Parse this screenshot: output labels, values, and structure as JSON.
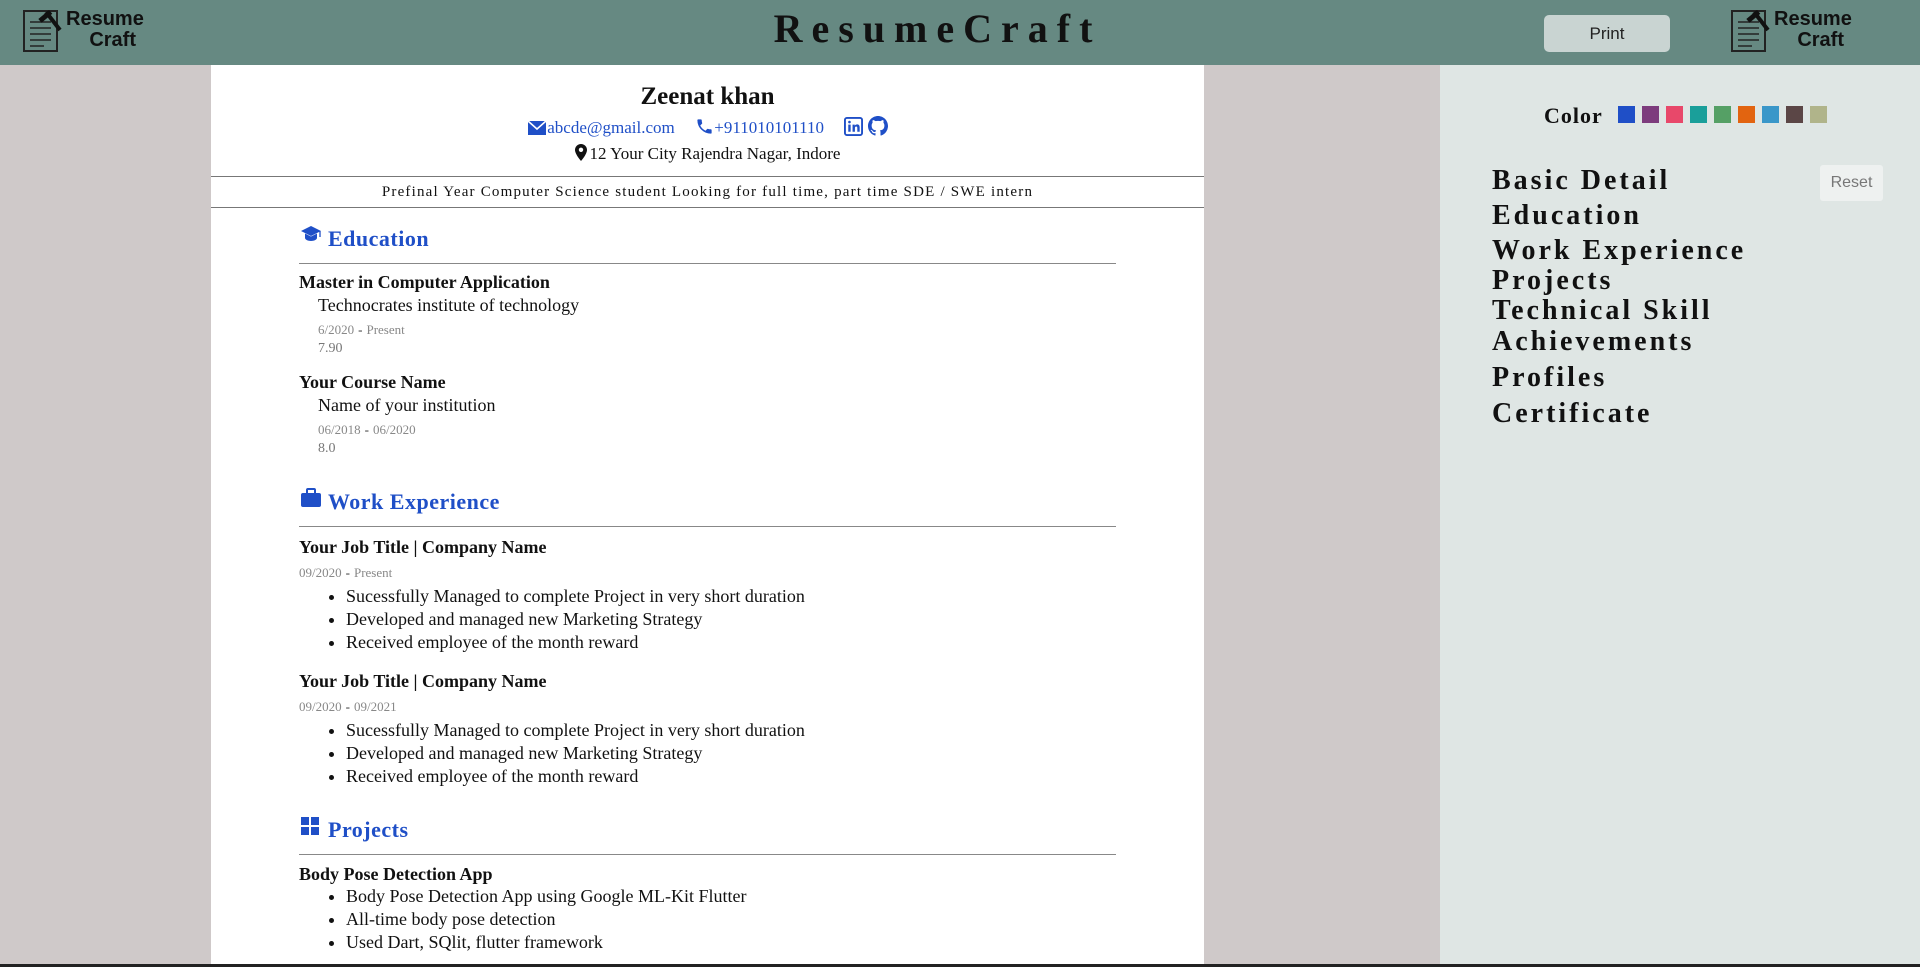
{
  "header": {
    "logo_line1": "Resume",
    "logo_line2": "Craft",
    "title": "ResumeCraft",
    "print_label": "Print"
  },
  "resume": {
    "name": "Zeenat khan",
    "email": "abcde@gmail.com",
    "phone": "+911010101110",
    "address": "12 Your City Rajendra Nagar, Indore",
    "objective": "Prefinal Year Computer Science student Looking for full time, part time SDE / SWE intern",
    "education": {
      "heading": "Education",
      "items": [
        {
          "degree": "Master in Computer Application",
          "institution": "Technocrates institute of technology",
          "start": "6/2020",
          "end": "Present",
          "score": "7.90"
        },
        {
          "degree": "Your Course Name",
          "institution": "Name of your institution",
          "start": "06/2018",
          "end": "06/2020",
          "score": "8.0"
        }
      ]
    },
    "experience": {
      "heading": "Work Experience",
      "items": [
        {
          "title": "Your Job Title | Company Name",
          "start": "09/2020",
          "end": "Present",
          "points": [
            "Sucessfully Managed to complete Project in very short duration",
            "Developed and managed new Marketing Strategy",
            "Received employee of the month reward"
          ]
        },
        {
          "title": "Your Job Title | Company Name",
          "start": "09/2020",
          "end": "09/2021",
          "points": [
            "Sucessfully Managed to complete Project in very short duration",
            "Developed and managed new Marketing Strategy",
            "Received employee of the month reward"
          ]
        }
      ]
    },
    "projects": {
      "heading": "Projects",
      "items": [
        {
          "title": "Body Pose Detection App",
          "points": [
            "Body Pose Detection App using Google ML-Kit Flutter",
            "All-time body pose detection",
            "Used Dart, SQlit, flutter framework"
          ]
        }
      ]
    }
  },
  "panel": {
    "color_label": "Color",
    "swatches": [
      "#1f4fc7",
      "#7d3c7d",
      "#e8486a",
      "#1a9f9a",
      "#55a065",
      "#e26410",
      "#3a97c9",
      "#5b4646",
      "#b0b48a"
    ],
    "reset_label": "Reset",
    "nav": [
      "Basic Detail",
      "Education",
      "Work Experience",
      "Projects",
      "Technical Skill",
      "Achievements",
      "Profiles",
      "Certificate"
    ]
  },
  "colors": {
    "topbar": "#668982",
    "accent": "#1f4fc7",
    "panel_bg": "#dfe6e4",
    "page_bg": "#cfc9c9"
  }
}
